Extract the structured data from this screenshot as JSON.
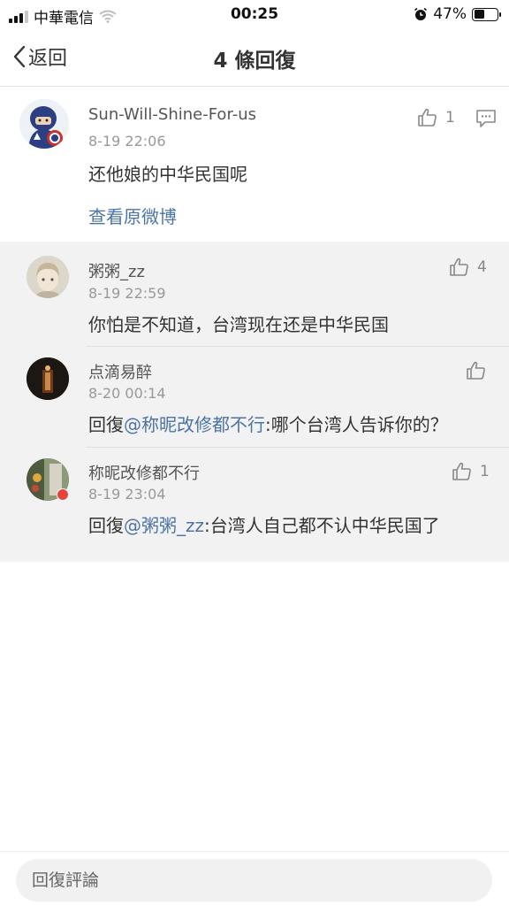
{
  "status_bar": {
    "carrier": "中華電信",
    "time": "00:25",
    "battery": "47%",
    "battery_level": 0.47
  },
  "nav": {
    "back_label": "返回",
    "title": "4 條回復"
  },
  "main_comment": {
    "username": "Sun-Will-Shine-For-us",
    "time": "8-19 22:06",
    "text": "还他娘的中华民国呢",
    "likes": "1",
    "view_original": "查看原微博"
  },
  "replies": [
    {
      "username": "粥粥_zz",
      "time": "8-19 22:59",
      "likes": "4",
      "text": "你怕是不知道，台湾现在还是中华民国"
    },
    {
      "username": "点滴易醉",
      "time": "8-20 00:14",
      "likes": "",
      "reply_prefix": "回復",
      "mention": "@称昵改修都不行",
      "text": ":哪个台湾人告诉你的？"
    },
    {
      "username": "称昵改修都不行",
      "time": "8-19 23:04",
      "likes": "1",
      "reply_prefix": "回復",
      "mention": "@粥粥_zz",
      "text": ":台湾人自己都不认中华民国了"
    }
  ],
  "bottom": {
    "placeholder": "回復評論"
  },
  "colors": {
    "link": "#4c74a6",
    "reply_bg": "#f2f2f2",
    "text": "#333333",
    "muted": "#999999"
  },
  "icons": [
    "signal-icon",
    "wifi-icon",
    "alarm-icon",
    "battery-icon",
    "back-chevron-icon",
    "thumbs-up-icon",
    "comment-icon"
  ]
}
